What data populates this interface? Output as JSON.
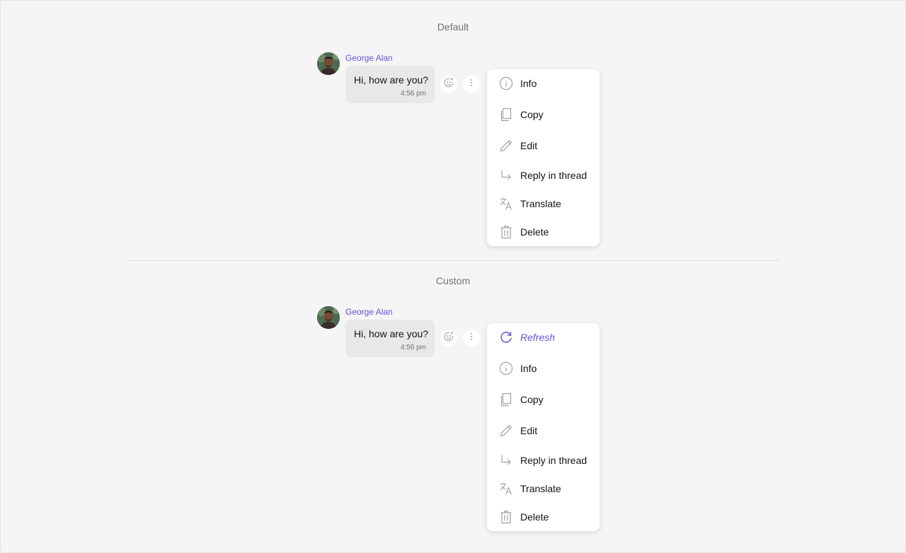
{
  "colors": {
    "accent": "#6852d6",
    "bubble": "#e8e8e8",
    "background": "#f5f5f5",
    "icon": "#a1a1a1"
  },
  "sections": {
    "default": {
      "label": "Default",
      "message": {
        "sender": "George Alan",
        "text": "Hi, how are you?",
        "time": "4:56 pm"
      },
      "menu": {
        "items": [
          {
            "label": "Info",
            "icon": "info-icon"
          },
          {
            "label": "Copy",
            "icon": "copy-icon"
          },
          {
            "label": "Edit",
            "icon": "edit-icon"
          },
          {
            "label": "Reply in thread",
            "icon": "reply-in-thread-icon"
          },
          {
            "label": "Translate",
            "icon": "translate-icon"
          },
          {
            "label": "Delete",
            "icon": "delete-icon"
          }
        ]
      }
    },
    "custom": {
      "label": "Custom",
      "message": {
        "sender": "George Alan",
        "text": "Hi, how are you?",
        "time": "4:56 pm"
      },
      "menu": {
        "items": [
          {
            "label": "Refresh",
            "icon": "refresh-icon"
          },
          {
            "label": "Info",
            "icon": "info-icon"
          },
          {
            "label": "Copy",
            "icon": "copy-icon"
          },
          {
            "label": "Edit",
            "icon": "edit-icon"
          },
          {
            "label": "Reply in thread",
            "icon": "reply-in-thread-icon"
          },
          {
            "label": "Translate",
            "icon": "translate-icon"
          },
          {
            "label": "Delete",
            "icon": "delete-icon"
          }
        ]
      }
    }
  }
}
